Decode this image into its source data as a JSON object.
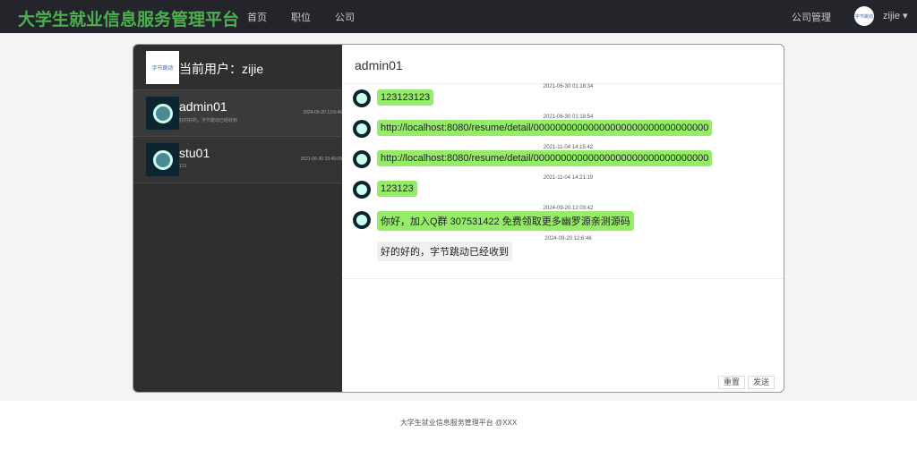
{
  "nav": {
    "brand": "大学生就业信息服务管理平台",
    "links": [
      "首页",
      "职位",
      "公司"
    ],
    "company_mgmt": "公司管理",
    "username": "zijie",
    "avatar_text": "字节跳动"
  },
  "sidebar": {
    "current_user": "当前用户：zijie",
    "logo_text": "字节跳动",
    "conversations": [
      {
        "name": "admin01",
        "preview": "好的好的，字节跳动已经收到",
        "time": "2024-09-20 12:6:46"
      },
      {
        "name": "stu01",
        "preview": "123",
        "time": "2021-06-30 10:46:09"
      }
    ]
  },
  "chat": {
    "title": "admin01",
    "messages": [
      {
        "time": "2021-06-30 01:18:34",
        "text": "123123123",
        "self": false
      },
      {
        "time": "2021-06-30 01:18:54",
        "text": "http://localhost:8080/resume/detail/00000000000000000000000000000000",
        "self": false
      },
      {
        "time": "2021-11-04 14:15:42",
        "text": "http://localhost:8080/resume/detail/00000000000000000000000000000000",
        "self": false
      },
      {
        "time": "2021-11-04 14:21:19",
        "text": "123123",
        "self": false
      },
      {
        "time": "2024-09-20 12:03:42",
        "text": "你好，加入Q群 307531422 免费领取更多幽罗源亲测源码",
        "self": false
      },
      {
        "time": "2024-09-20 12:6:46",
        "text": "好的好的，字节跳动已经收到",
        "self": true
      }
    ],
    "reset": "重置",
    "send": "发送"
  },
  "footer": "大学生就业信息服务管理平台 @XXX"
}
